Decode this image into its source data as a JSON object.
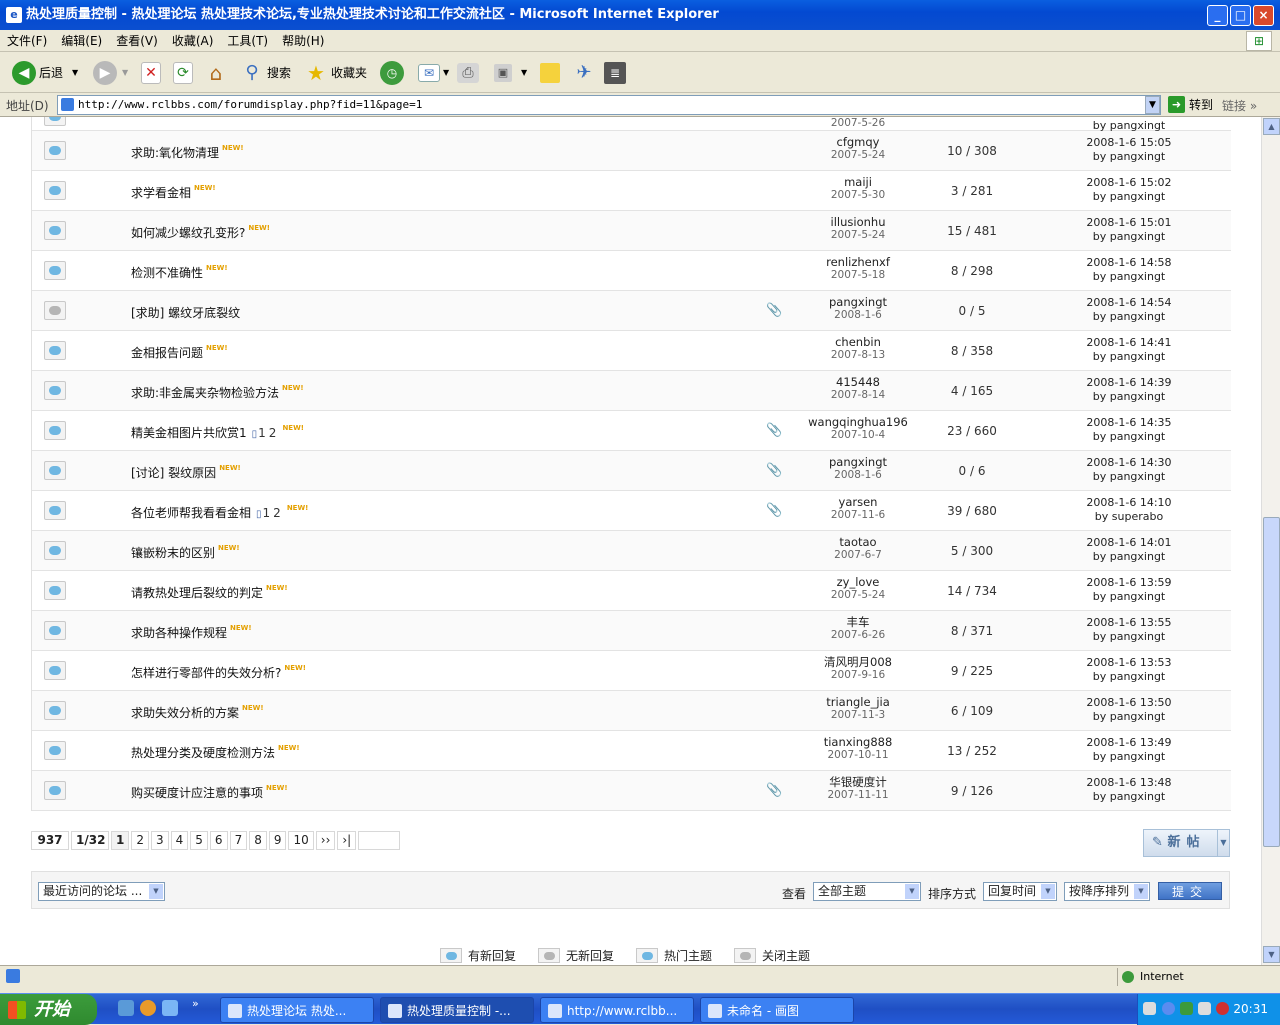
{
  "window": {
    "title": "热处理质量控制 - 热处理论坛 热处理技术论坛,专业热处理技术讨论和工作交流社区 - Microsoft Internet Explorer"
  },
  "menu": [
    "文件(F)",
    "编辑(E)",
    "查看(V)",
    "收藏(A)",
    "工具(T)",
    "帮助(H)"
  ],
  "toolbar": {
    "back": "后退",
    "search": "搜索",
    "favorites": "收藏夹"
  },
  "address": {
    "label": "地址(D)",
    "url": "http://www.rclbbs.com/forumdisplay.php?fid=11&page=1",
    "go": "转到",
    "links": "链接"
  },
  "threads": [
    {
      "title": "求助:氧化物清理",
      "new": true,
      "attach": false,
      "pages": [],
      "author": "cfgmqy",
      "date": "2007-5-24",
      "replies": "10 / 308",
      "last_time": "2008-1-6 15:05",
      "last_by": "by pangxingt",
      "icon": "normal"
    },
    {
      "title": "求学看金相",
      "new": true,
      "attach": false,
      "pages": [],
      "author": "maiji",
      "date": "2007-5-30",
      "replies": "3 / 281",
      "last_time": "2008-1-6 15:02",
      "last_by": "by pangxingt",
      "icon": "normal"
    },
    {
      "title": "如何减少螺纹孔变形?",
      "new": true,
      "attach": false,
      "pages": [],
      "author": "illusionhu",
      "date": "2007-5-24",
      "replies": "15 / 481",
      "last_time": "2008-1-6 15:01",
      "last_by": "by pangxingt",
      "icon": "normal"
    },
    {
      "title": "检测不准确性",
      "new": true,
      "attach": false,
      "pages": [],
      "author": "renlizhenxf",
      "date": "2007-5-18",
      "replies": "8 / 298",
      "last_time": "2008-1-6 14:58",
      "last_by": "by pangxingt",
      "icon": "normal"
    },
    {
      "title": "[求助] 螺纹牙底裂纹",
      "new": false,
      "attach": true,
      "pages": [],
      "author": "pangxingt",
      "date": "2008-1-6",
      "replies": "0 / 5",
      "last_time": "2008-1-6 14:54",
      "last_by": "by pangxingt",
      "icon": "grey"
    },
    {
      "title": "金相报告问题",
      "new": true,
      "attach": false,
      "pages": [],
      "author": "chenbin",
      "date": "2007-8-13",
      "replies": "8 / 358",
      "last_time": "2008-1-6 14:41",
      "last_by": "by pangxingt",
      "icon": "normal"
    },
    {
      "title": "求助:非金属夹杂物检验方法",
      "new": true,
      "attach": false,
      "pages": [],
      "author": "415448",
      "date": "2007-8-14",
      "replies": "4 / 165",
      "last_time": "2008-1-6 14:39",
      "last_by": "by pangxingt",
      "icon": "normal"
    },
    {
      "title": "精美金相图片共欣赏1",
      "new": true,
      "attach": true,
      "pages": [
        "1",
        "2"
      ],
      "author": "wangqinghua196",
      "date": "2007-10-4",
      "replies": "23 / 660",
      "last_time": "2008-1-6 14:35",
      "last_by": "by pangxingt",
      "icon": "normal"
    },
    {
      "title": "[讨论] 裂纹原因",
      "new": true,
      "attach": true,
      "pages": [],
      "author": "pangxingt",
      "date": "2008-1-6",
      "replies": "0 / 6",
      "last_time": "2008-1-6 14:30",
      "last_by": "by pangxingt",
      "icon": "normal"
    },
    {
      "title": "各位老师帮我看看金相",
      "new": true,
      "attach": true,
      "pages": [
        "1",
        "2"
      ],
      "author": "yarsen",
      "date": "2007-11-6",
      "replies": "39 / 680",
      "last_time": "2008-1-6 14:10",
      "last_by": "by superabo",
      "icon": "normal"
    },
    {
      "title": "镶嵌粉末的区别",
      "new": true,
      "attach": false,
      "pages": [],
      "author": "taotao",
      "date": "2007-6-7",
      "replies": "5 / 300",
      "last_time": "2008-1-6 14:01",
      "last_by": "by pangxingt",
      "icon": "normal"
    },
    {
      "title": "请教热处理后裂纹的判定",
      "new": true,
      "attach": false,
      "pages": [],
      "author": "zy_love",
      "date": "2007-5-24",
      "replies": "14 / 734",
      "last_time": "2008-1-6 13:59",
      "last_by": "by pangxingt",
      "icon": "normal"
    },
    {
      "title": "求助各种操作规程",
      "new": true,
      "attach": false,
      "pages": [],
      "author": "丰车",
      "date": "2007-6-26",
      "replies": "8 / 371",
      "last_time": "2008-1-6 13:55",
      "last_by": "by pangxingt",
      "icon": "normal"
    },
    {
      "title": "怎样进行零部件的失效分析?",
      "new": true,
      "attach": false,
      "pages": [],
      "author": "清风明月008",
      "date": "2007-9-16",
      "replies": "9 / 225",
      "last_time": "2008-1-6 13:53",
      "last_by": "by pangxingt",
      "icon": "normal"
    },
    {
      "title": "求助失效分析的方案",
      "new": true,
      "attach": false,
      "pages": [],
      "author": "triangle_jia",
      "date": "2007-11-3",
      "replies": "6 / 109",
      "last_time": "2008-1-6 13:50",
      "last_by": "by pangxingt",
      "icon": "normal"
    },
    {
      "title": "热处理分类及硬度检测方法",
      "new": true,
      "attach": false,
      "pages": [],
      "author": "tianxing888",
      "date": "2007-10-11",
      "replies": "13 / 252",
      "last_time": "2008-1-6 13:49",
      "last_by": "by pangxingt",
      "icon": "normal"
    },
    {
      "title": "购买硬度计应注意的事项",
      "new": true,
      "attach": true,
      "pages": [],
      "author": "华银硬度计",
      "date": "2007-11-11",
      "replies": "9 / 126",
      "last_time": "2008-1-6 13:48",
      "last_by": "by pangxingt",
      "icon": "normal"
    }
  ],
  "new_badge": "NEW!",
  "pager": {
    "total": "937",
    "current": "1/32",
    "pages": [
      "1",
      "2",
      "3",
      "4",
      "5",
      "6",
      "7",
      "8",
      "9",
      "10"
    ],
    "next": "››",
    "last": "›|"
  },
  "new_post": "新帖",
  "filter": {
    "recent_forums": "最近访问的论坛 ...",
    "view_label": "查看",
    "view_value": "全部主题",
    "sort_label": "排序方式",
    "sort_value": "回复时间",
    "order_value": "按降序排列",
    "submit": "提交"
  },
  "legend": [
    "有新回复",
    "无新回复",
    "热门主题",
    "关闭主题"
  ],
  "status": {
    "zone": "Internet"
  },
  "taskbar": {
    "start": "开始",
    "tasks": [
      "热处理论坛 热处...",
      "热处理质量控制 -...",
      "http://www.rclbb...",
      "未命名 - 画图"
    ],
    "time": "20:31"
  }
}
